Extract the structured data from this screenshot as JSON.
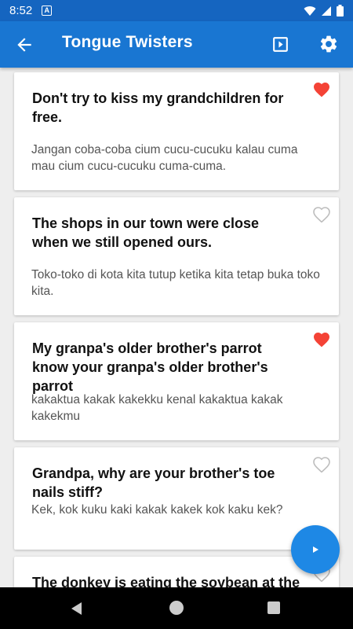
{
  "status_bar": {
    "time": "8:52",
    "notification_icon": "a-icon",
    "wifi_icon": "wifi-icon",
    "signal_icon": "signal-icon",
    "battery_icon": "battery-icon"
  },
  "app_bar": {
    "title": "Tongue Twisters",
    "back_icon": "arrow-back-icon",
    "play_icon": "slideshow-icon",
    "settings_icon": "gear-icon",
    "color": "#1976d2"
  },
  "cards": [
    {
      "title": "Don't try to kiss my grandchildren for free.",
      "translation": "Jangan coba-coba cium cucu-cucuku kalau cuma mau cium cucu-cucuku cuma-cuma.",
      "favorite": true
    },
    {
      "title": "The shops in our town were close when we still opened ours.",
      "translation": "Toko-toko di kota kita tutup ketika kita tetap buka toko kita.",
      "favorite": false
    },
    {
      "title": "My granpa's older brother's parrot know your granpa's older brother's parrot",
      "translation": "kakaktua kakak kakekku kenal kakaktua kakak kakekmu",
      "favorite": true
    },
    {
      "title": "Grandpa, why are your brother's toe nails stiff?",
      "translation": "Kek, kok kuku kaki kakak kakek kok kaku kek?",
      "favorite": false
    },
    {
      "title": "The donkey is eating the soybean at the",
      "translation": "",
      "favorite": false
    }
  ],
  "fab": {
    "icon": "play-icon",
    "color": "#1e88e5"
  },
  "colors": {
    "favorite": "#f44336",
    "unfavorite": "#bdbdbd"
  }
}
